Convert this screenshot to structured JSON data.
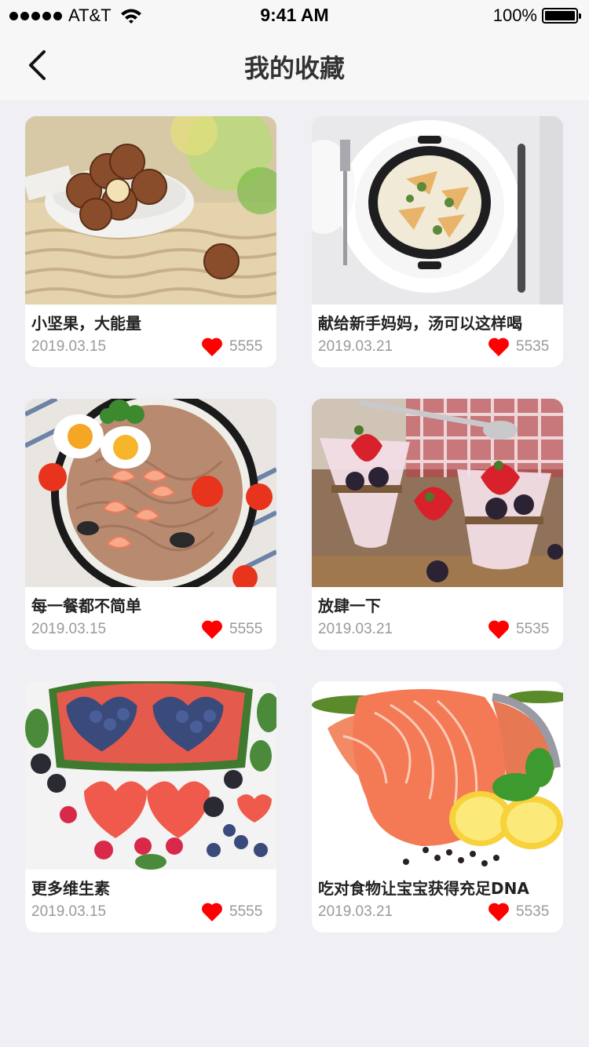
{
  "status_bar": {
    "carrier": "AT&T",
    "time": "9:41 AM",
    "battery": "100%"
  },
  "nav": {
    "title": "我的收藏",
    "back_icon": "chevron-left-icon"
  },
  "colors": {
    "background": "#efeff4",
    "heart": "#ff0000",
    "meta_text": "#9a9a9a"
  },
  "cards": [
    {
      "title": "小坚果，大能量",
      "date": "2019.03.15",
      "likes": "5555",
      "image": "macadamia-nuts-photo"
    },
    {
      "title": "献给新手妈妈，汤可以这样喝",
      "date": "2019.03.21",
      "likes": "5535",
      "image": "risotto-pot-photo"
    },
    {
      "title": "每一餐都不简单",
      "date": "2019.03.15",
      "likes": "5555",
      "image": "shrimp-noodle-bowl-photo"
    },
    {
      "title": "放肆一下",
      "date": "2019.03.21",
      "likes": "5535",
      "image": "berry-yogurt-parfait-photo"
    },
    {
      "title": "更多维生素",
      "date": "2019.03.15",
      "likes": "5555",
      "image": "watermelon-berries-photo"
    },
    {
      "title": "吃对食物让宝宝获得充足DNA",
      "date": "2019.03.21",
      "likes": "5535",
      "image": "salmon-steak-photo"
    }
  ]
}
